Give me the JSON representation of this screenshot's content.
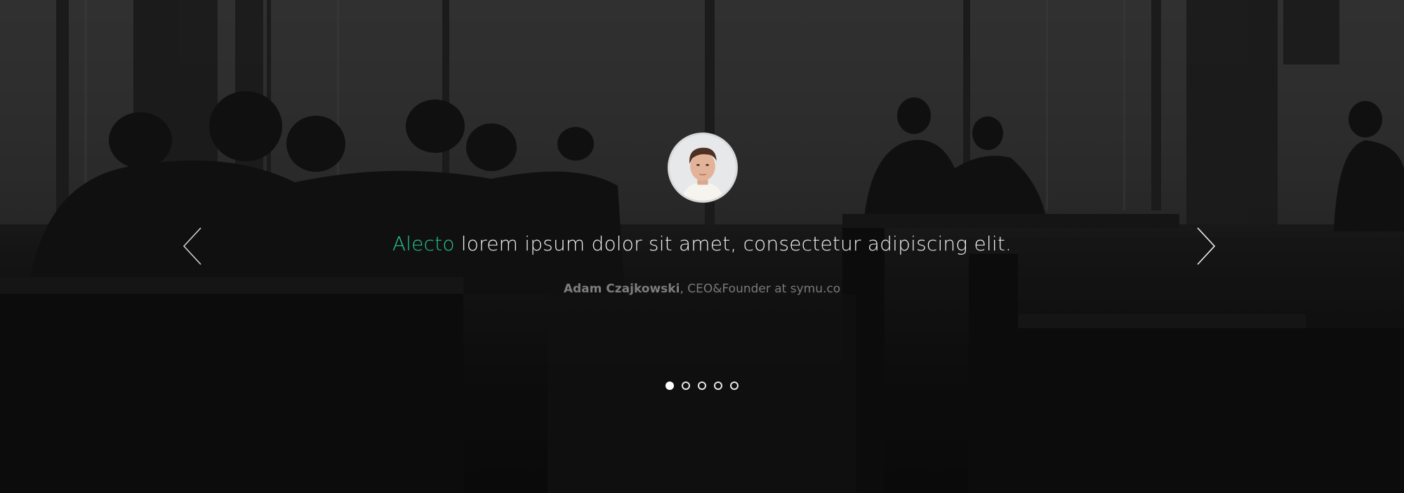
{
  "testimonial": {
    "quote_accent": "Alecto",
    "quote_text": " lorem ipsum dolor sit amet, consectetur adipiscing elit.",
    "author_name": "Adam Czajkowski",
    "author_role": ", CEO&Founder at symu.co"
  },
  "carousel": {
    "active_index": 0,
    "dot_count": 5
  },
  "colors": {
    "accent": "#27c28f",
    "quote_text": "#f2f2f2",
    "author_text": "#7a7a7a"
  },
  "icons": {
    "prev": "chevron-left-icon",
    "next": "chevron-right-icon"
  }
}
